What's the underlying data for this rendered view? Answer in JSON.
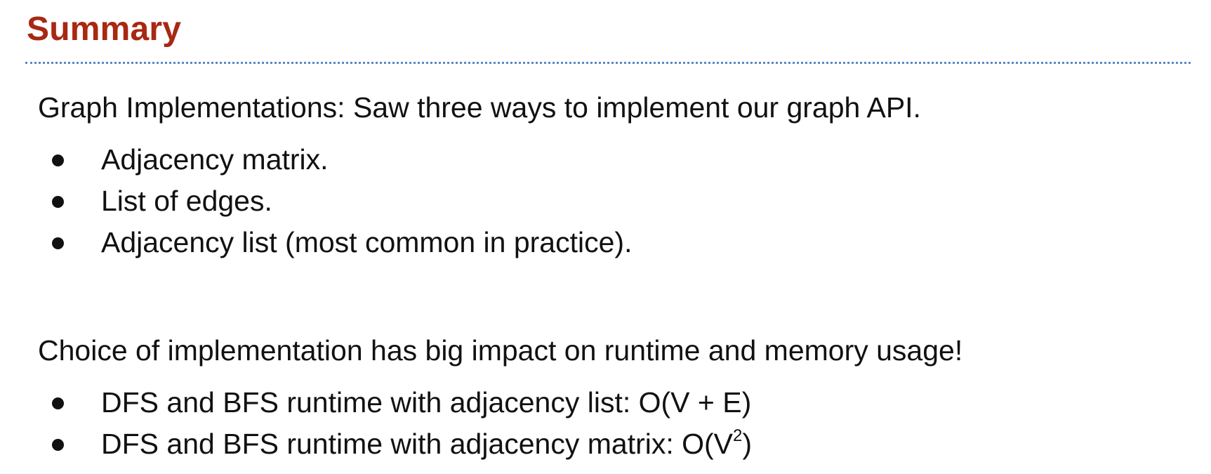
{
  "slide": {
    "title": "Summary",
    "accent_color": "#a82812",
    "rule_color": "#5b87c8"
  },
  "sections": [
    {
      "lead": "Graph Implementations: Saw three ways to implement our graph API.",
      "bullets": [
        "Adjacency matrix.",
        "List of edges.",
        "Adjacency list (most common in practice)."
      ]
    },
    {
      "lead": "Choice of implementation has big impact on runtime and memory usage!",
      "bullets": [
        "DFS and BFS runtime with adjacency list: O(V + E)",
        {
          "text": "DFS and BFS runtime with adjacency matrix: O(V",
          "superscript": "2",
          "suffix": ")"
        }
      ]
    }
  ]
}
